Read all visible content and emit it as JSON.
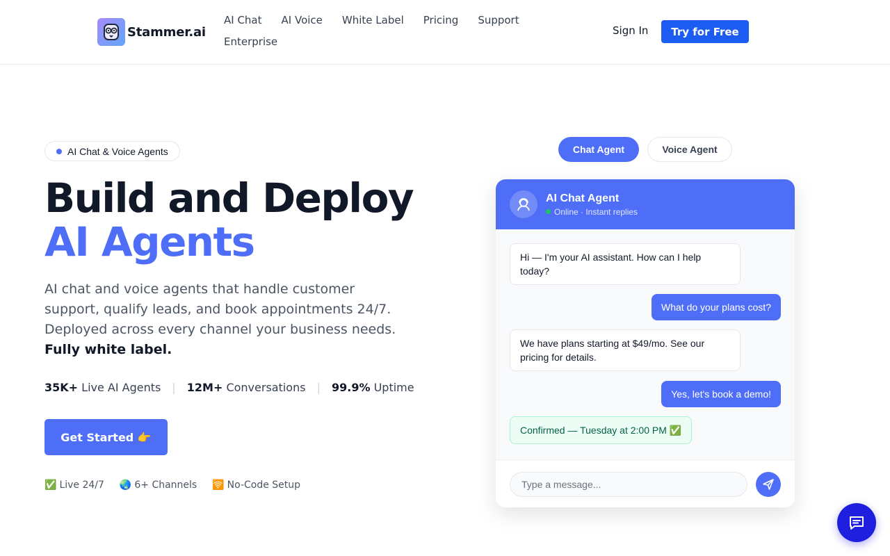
{
  "header": {
    "brand": "Stammer.ai",
    "nav": [
      "AI Chat",
      "AI Voice",
      "White Label",
      "Pricing",
      "Support",
      "Enterprise"
    ],
    "sign_in": "Sign In",
    "try_free": "Try for Free"
  },
  "hero": {
    "badge": "AI Chat & Voice Agents",
    "title_line1": "Build and Deploy",
    "title_line2": "AI Agents",
    "lead": "AI chat and voice agents that handle customer support, qualify leads, and book appointments 24/7. Deployed across every channel your business needs.",
    "lead_bold": "Fully white label.",
    "stats": [
      {
        "value": "35K+",
        "label": "Live AI Agents"
      },
      {
        "value": "12M+",
        "label": "Conversations"
      },
      {
        "value": "99.9%",
        "label": "Uptime"
      }
    ],
    "cta": "Get Started 👉",
    "features": [
      {
        "icon": "✅",
        "label": "Live 24/7"
      },
      {
        "icon": "🌏",
        "label": "6+ Channels"
      },
      {
        "icon": "🛜",
        "label": "No-Code Setup"
      }
    ]
  },
  "toggle": {
    "chat": "Chat Agent",
    "voice": "Voice Agent"
  },
  "chat": {
    "title": "AI Chat Agent",
    "status": "Online · Instant replies",
    "messages": [
      {
        "from": "bot",
        "text": "Hi — I'm your AI assistant. How can I help today?"
      },
      {
        "from": "user",
        "text": "What do your plans cost?"
      },
      {
        "from": "bot",
        "text": "We have plans starting at $49/mo. See our pricing for details."
      },
      {
        "from": "user",
        "text": "Yes, let's book a demo!"
      },
      {
        "from": "confirm",
        "text": "Confirmed — Tuesday at 2:00 PM ✅"
      }
    ],
    "input_placeholder": "Type a message..."
  },
  "colors": {
    "accent": "#4f6ef7",
    "primary_button": "#1d5cf2",
    "fab": "#1f1fe0"
  }
}
